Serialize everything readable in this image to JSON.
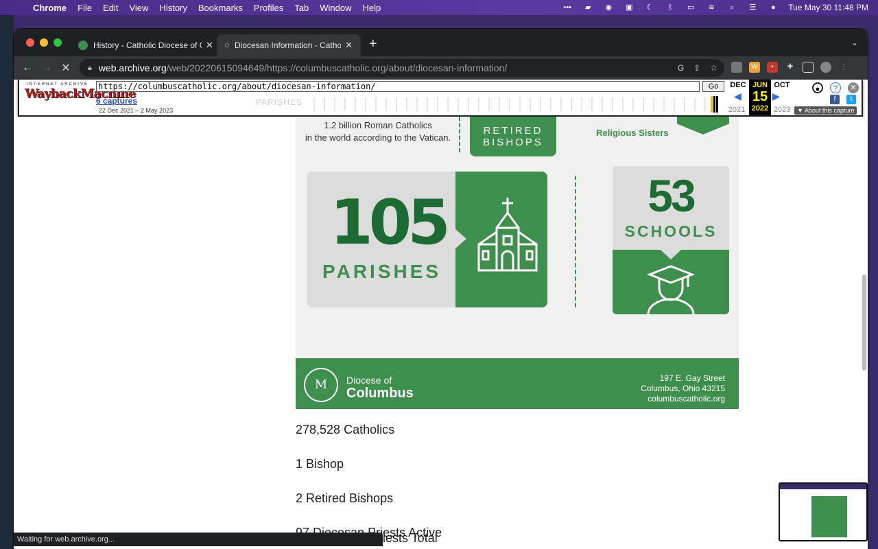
{
  "menubar": {
    "app": "Chrome",
    "items": [
      "File",
      "Edit",
      "View",
      "History",
      "Bookmarks",
      "Profiles",
      "Tab",
      "Window",
      "Help"
    ],
    "clock": "Tue May 30  11:48 PM"
  },
  "tabs": [
    {
      "title": "History - Catholic Diocese of C",
      "close": "✕"
    },
    {
      "title": "Diocesan Information - Catholic",
      "close": "✕"
    }
  ],
  "toolbar": {
    "url_domain": "web.archive.org",
    "url_path": "/web/20220615094649/https://columbuscatholic.org/about/diocesan-information/"
  },
  "wayback": {
    "logo_top": "INTERNET ARCHIVE",
    "logo_main": "WaybackMachine",
    "url": "https://columbuscatholic.org/about/diocesan-information/",
    "go": "Go",
    "captures": "6 captures",
    "range": "22 Dec 2021 – 2 May 2023",
    "ghost_nav": "PARISHES",
    "prev_month": "DEC",
    "cur_month": "JUN",
    "next_month": "OCT",
    "day": "15",
    "prev_year": "2021",
    "cur_year": "2022",
    "next_year": "2023",
    "about": "▼ About this capture"
  },
  "infographic": {
    "top_catholics": "1.2 billion Roman Catholics",
    "top_catholics_2": "in the world according to the Vatican.",
    "retired_1": "RETIRED",
    "retired_2": "BISHOPS",
    "sisters": "Religious Sisters",
    "parishes_num": "105",
    "parishes_label": "PARISHES",
    "schools_num": "53",
    "schools_label": "SCHOOLS",
    "diocese_small": "Diocese of",
    "diocese_big": "Columbus",
    "addr_1": "197 E. Gay Street",
    "addr_2": "Columbus, Ohio 43215",
    "addr_3": "columbuscatholic.org"
  },
  "stats": [
    "278,528 Catholics",
    "1 Bishop",
    "2 Retired Bishops",
    "97 Diocesan Priests Active"
  ],
  "partial_stat": "iests Total",
  "status": "Waiting for web.archive.org...",
  "colors": {
    "brand_green": "#3e8e4e",
    "dark_green": "#1d6b34"
  }
}
